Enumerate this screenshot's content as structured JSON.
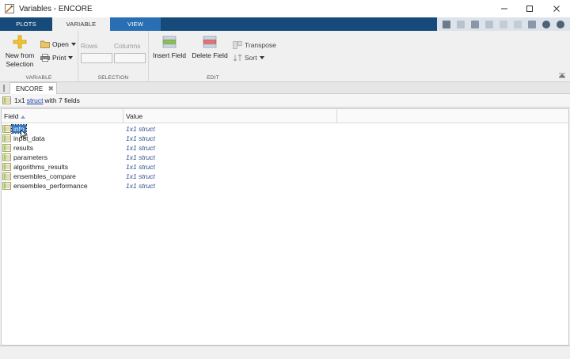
{
  "window": {
    "title": "Variables - ENCORE",
    "controls": [
      "minimize-icon",
      "maximize-icon",
      "close-icon"
    ]
  },
  "ribbon_tabs": [
    {
      "label": "PLOTS",
      "active": false
    },
    {
      "label": "VARIABLE",
      "active": true
    },
    {
      "label": "VIEW",
      "active": false
    }
  ],
  "ribbon": {
    "variable_group": {
      "label": "VARIABLE",
      "new_from_selection_line1": "New from",
      "new_from_selection_line2": "Selection",
      "open_label": "Open",
      "print_label": "Print"
    },
    "selection_group": {
      "label": "SELECTION",
      "rows_label": "Rows",
      "columns_label": "Columns"
    },
    "edit_group": {
      "label": "EDIT",
      "insert_field_label": "Insert Field",
      "delete_field_label": "Delete Field",
      "transpose_label": "Transpose",
      "sort_label": "Sort"
    }
  },
  "document_tab": {
    "label": "ENCORE"
  },
  "info": {
    "prefix": "1x1",
    "link": "struct",
    "suffix": "with 7 fields"
  },
  "table": {
    "columns": [
      "Field",
      "Value"
    ],
    "rows": [
      {
        "field": "info",
        "value": "1x1 struct",
        "selected": true
      },
      {
        "field": "input_data",
        "value": "1x1 struct"
      },
      {
        "field": "results",
        "value": "1x1 struct"
      },
      {
        "field": "parameters",
        "value": "1x1 struct"
      },
      {
        "field": "algorithms_results",
        "value": "1x1 struct"
      },
      {
        "field": "ensembles_compare",
        "value": "1x1 struct"
      },
      {
        "field": "ensembles_performance",
        "value": "1x1 struct"
      }
    ]
  },
  "colors": {
    "tabstrip": "#164a7a",
    "view_tab": "#2a6fb3",
    "selection": "#2b78c8",
    "value_text": "#2f4f8f"
  }
}
